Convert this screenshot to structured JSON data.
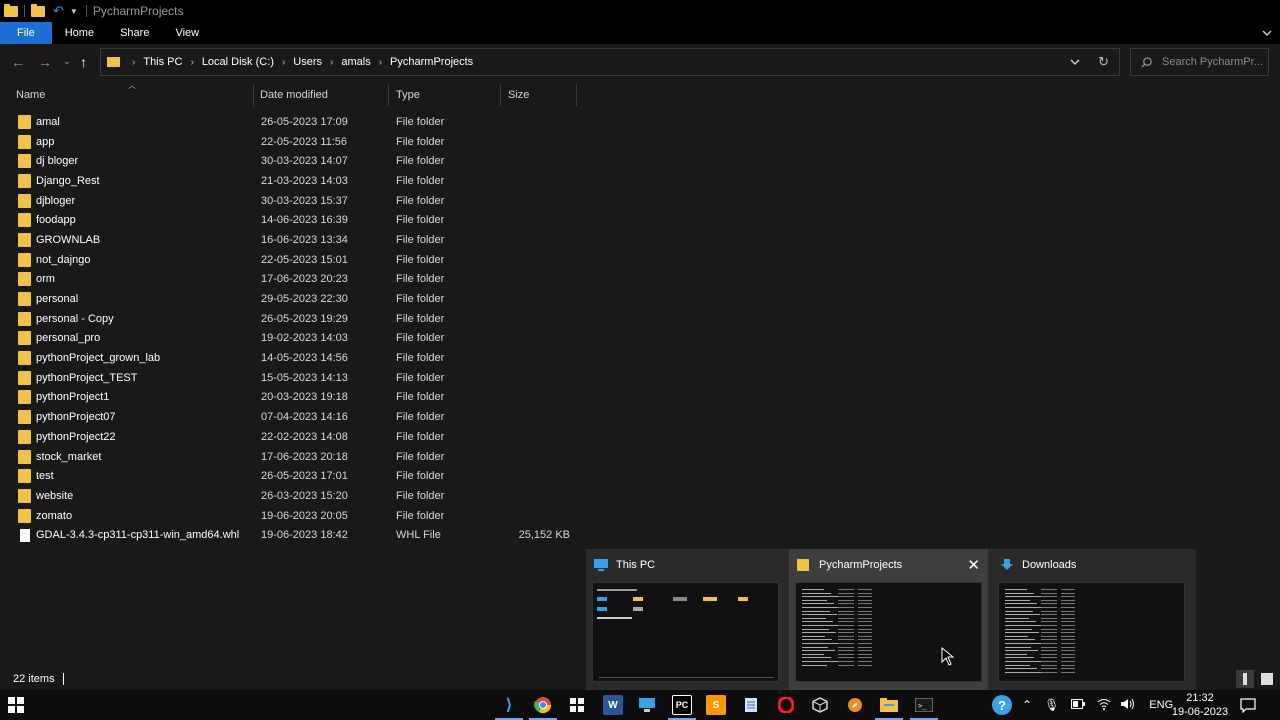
{
  "window": {
    "title": "PycharmProjects"
  },
  "ribbon": {
    "tabs": [
      "File",
      "Home",
      "Share",
      "View"
    ]
  },
  "address": {
    "crumbs": [
      "This PC",
      "Local Disk (C:)",
      "Users",
      "amals",
      "PycharmProjects"
    ]
  },
  "search": {
    "placeholder": "Search PycharmPr..."
  },
  "columns": {
    "name": "Name",
    "date": "Date modified",
    "type": "Type",
    "size": "Size"
  },
  "files": [
    {
      "name": "amal",
      "date": "26-05-2023 17:09",
      "type": "File folder",
      "size": "",
      "kind": "folder"
    },
    {
      "name": "app",
      "date": "22-05-2023 11:56",
      "type": "File folder",
      "size": "",
      "kind": "folder"
    },
    {
      "name": "dj bloger",
      "date": "30-03-2023 14:07",
      "type": "File folder",
      "size": "",
      "kind": "folder"
    },
    {
      "name": "Django_Rest",
      "date": "21-03-2023 14:03",
      "type": "File folder",
      "size": "",
      "kind": "folder"
    },
    {
      "name": "djbloger",
      "date": "30-03-2023 15:37",
      "type": "File folder",
      "size": "",
      "kind": "folder"
    },
    {
      "name": "foodapp",
      "date": "14-06-2023 16:39",
      "type": "File folder",
      "size": "",
      "kind": "folder"
    },
    {
      "name": "GROWNLAB",
      "date": "16-06-2023 13:34",
      "type": "File folder",
      "size": "",
      "kind": "folder"
    },
    {
      "name": "not_dajngo",
      "date": "22-05-2023 15:01",
      "type": "File folder",
      "size": "",
      "kind": "folder"
    },
    {
      "name": "orm",
      "date": "17-06-2023 20:23",
      "type": "File folder",
      "size": "",
      "kind": "folder"
    },
    {
      "name": "personal",
      "date": "29-05-2023 22:30",
      "type": "File folder",
      "size": "",
      "kind": "folder"
    },
    {
      "name": "personal - Copy",
      "date": "26-05-2023 19:29",
      "type": "File folder",
      "size": "",
      "kind": "folder"
    },
    {
      "name": "personal_pro",
      "date": "19-02-2023 14:03",
      "type": "File folder",
      "size": "",
      "kind": "folder"
    },
    {
      "name": "pythonProject_grown_lab",
      "date": "14-05-2023 14:56",
      "type": "File folder",
      "size": "",
      "kind": "folder"
    },
    {
      "name": "pythonProject_TEST",
      "date": "15-05-2023 14:13",
      "type": "File folder",
      "size": "",
      "kind": "folder"
    },
    {
      "name": "pythonProject1",
      "date": "20-03-2023 19:18",
      "type": "File folder",
      "size": "",
      "kind": "folder"
    },
    {
      "name": "pythonProject07",
      "date": "07-04-2023 14:16",
      "type": "File folder",
      "size": "",
      "kind": "folder"
    },
    {
      "name": "pythonProject22",
      "date": "22-02-2023 14:08",
      "type": "File folder",
      "size": "",
      "kind": "folder"
    },
    {
      "name": "stock_market",
      "date": "17-06-2023 20:18",
      "type": "File folder",
      "size": "",
      "kind": "folder"
    },
    {
      "name": "test",
      "date": "26-05-2023 17:01",
      "type": "File folder",
      "size": "",
      "kind": "folder"
    },
    {
      "name": "website",
      "date": "26-03-2023 15:20",
      "type": "File folder",
      "size": "",
      "kind": "folder"
    },
    {
      "name": "zomato",
      "date": "19-06-2023 20:05",
      "type": "File folder",
      "size": "",
      "kind": "folder"
    },
    {
      "name": "GDAL-3.4.3-cp311-cp311-win_amd64.whl",
      "date": "19-06-2023 18:42",
      "type": "WHL File",
      "size": "25,152 KB",
      "kind": "file"
    }
  ],
  "status": {
    "items": "22 items"
  },
  "previews": [
    {
      "title": "This PC",
      "icon": "computer-icon"
    },
    {
      "title": "PycharmProjects",
      "icon": "folder-icon"
    },
    {
      "title": "Downloads",
      "icon": "download-icon"
    }
  ],
  "tray": {
    "language": "ENG",
    "time": "21:32",
    "date": "19-06-2023"
  },
  "colors": {
    "accent": "#1c6ed4",
    "folder": "#f0c14b",
    "background": "#191919"
  }
}
